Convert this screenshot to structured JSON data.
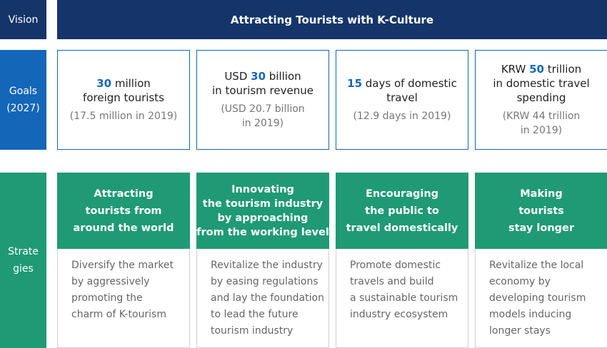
{
  "vision": {
    "label": "Vision",
    "text": "Attracting Tourists with K-Culture"
  },
  "goals": {
    "label_lines": [
      "Goals",
      "(2027)"
    ],
    "items": [
      {
        "main": [
          [
            {
              "t": "30",
              "num": true
            },
            {
              "t": " million"
            }
          ],
          [
            {
              "t": "foreign tourists"
            }
          ]
        ],
        "sub": [
          "(17.5 million in 2019)"
        ]
      },
      {
        "main": [
          [
            {
              "t": "USD "
            },
            {
              "t": "30",
              "num": true
            },
            {
              "t": " billion"
            }
          ],
          [
            {
              "t": "in tourism revenue"
            }
          ]
        ],
        "sub": [
          "(USD 20.7 billion",
          "in 2019)"
        ]
      },
      {
        "main": [
          [
            {
              "t": "15",
              "num": true
            },
            {
              "t": " days of domestic"
            }
          ],
          [
            {
              "t": "travel"
            }
          ]
        ],
        "sub": [
          "(12.9 days in 2019)"
        ]
      },
      {
        "main": [
          [
            {
              "t": "KRW "
            },
            {
              "t": "50",
              "num": true
            },
            {
              "t": " trillion"
            }
          ],
          [
            {
              "t": "in domestic travel"
            }
          ],
          [
            {
              "t": "spending"
            }
          ]
        ],
        "sub": [
          "(KRW 44 trillion",
          "in 2019)"
        ]
      }
    ]
  },
  "strategies": {
    "label_lines": [
      "Strate",
      "gies"
    ],
    "items": [
      {
        "title": [
          "Attracting",
          "tourists from",
          "around the world"
        ],
        "desc": [
          "Diversify the market",
          "by aggressively",
          "promoting the",
          "charm of K-tourism"
        ]
      },
      {
        "title": [
          "Innovating",
          "the tourism industry",
          "by approaching",
          "from the working level"
        ],
        "desc": [
          "Revitalize the industry",
          "by easing regulations",
          "and lay the foundation",
          "to lead the future",
          "tourism industry"
        ]
      },
      {
        "title": [
          "Encouraging",
          "the public to",
          "travel domestically"
        ],
        "desc": [
          "Promote domestic",
          "travels and build",
          "a sustainable tourism",
          "industry ecosystem"
        ]
      },
      {
        "title": [
          "Making",
          "tourists",
          "stay longer"
        ],
        "desc": [
          "Revitalize the local",
          "economy by",
          "developing tourism",
          "models inducing",
          "longer stays"
        ]
      }
    ]
  },
  "colors": {
    "vision_navy": "#15356a",
    "goals_blue": "#1466b8",
    "strategy_green": "#1f9a74"
  }
}
